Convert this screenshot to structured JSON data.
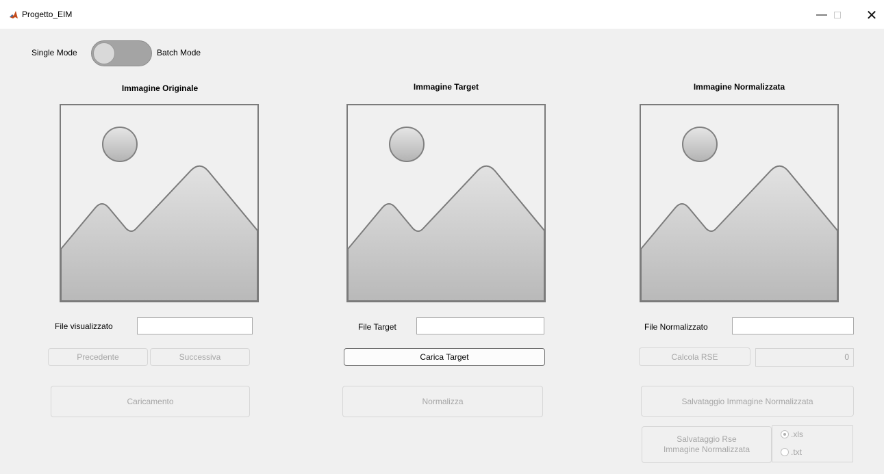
{
  "window": {
    "title": "Progetto_EIM",
    "minimize": "—",
    "close": "✕"
  },
  "mode_toggle": {
    "left_label": "Single Mode",
    "right_label": "Batch Mode",
    "state": "Single Mode"
  },
  "panels": {
    "original": {
      "heading": "Immagine Originale",
      "file_label": "File visualizzato",
      "file_value": "",
      "prev_label": "Precedente",
      "next_label": "Successiva",
      "load_label": "Caricamento"
    },
    "target": {
      "heading": "Immagine Target",
      "file_label": "File Target",
      "file_value": "",
      "load_label": "Carica Target",
      "normalize_label": "Normalizza"
    },
    "normalized": {
      "heading": "Immagine Normalizzata",
      "file_label": "File Normalizzato",
      "file_value": "",
      "rse_button": "Calcola RSE",
      "rse_value": "0",
      "save_image_label": "Salvataggio Immagine Normalizzata",
      "save_rse_line1": "Salvataggio Rse",
      "save_rse_line2": "Immagine Normalizzata",
      "format_options": [
        ".xls",
        ".txt"
      ],
      "format_selected": ".xls"
    }
  },
  "colors": {
    "client_bg": "#f0f0f0",
    "toggle_track": "#a4a4a4",
    "placeholder_frame": "#7b7b7b"
  }
}
